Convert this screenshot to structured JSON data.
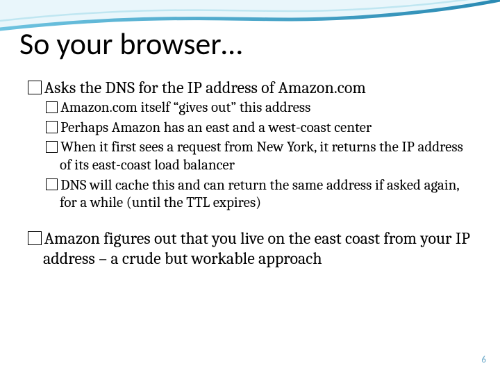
{
  "title": "So your browser…",
  "bullets": {
    "b1": "Asks the DNS for the IP address of Amazon.com",
    "sub": {
      "s1": "Amazon.com itself “gives out” this address",
      "s2": "Perhaps Amazon has an east and a west-coast center",
      "s3": "When it first sees a request from New York, it returns the IP address of its east-coast load balancer",
      "s4": "DNS will cache this and can return the same address if asked again, for a while (until the TTL expires)"
    },
    "b2": "Amazon figures out that you live on the east coast from your IP address – a crude but workable approach"
  },
  "page_number": "6"
}
